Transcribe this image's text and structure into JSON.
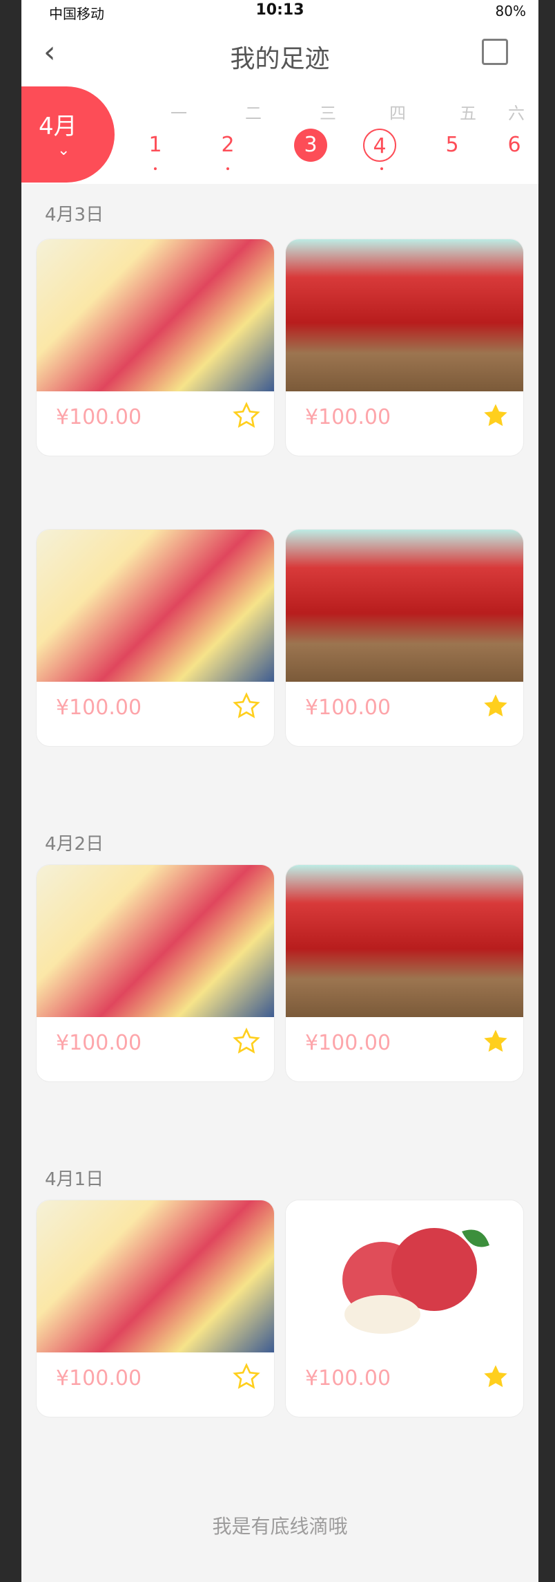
{
  "status": {
    "carrier": "中国移动",
    "time": "10:13",
    "battery": "80%"
  },
  "nav": {
    "back": "‹",
    "title": "我的足迹"
  },
  "calendar": {
    "month": "4月",
    "weekdays": [
      "一",
      "二",
      "三",
      "四",
      "五",
      "六"
    ],
    "days": [
      "1",
      "2",
      "3",
      "4",
      "5",
      "6"
    ]
  },
  "groups": [
    {
      "date": "4月3日",
      "items": [
        {
          "price": "¥100.00",
          "starred": false,
          "img": "fruit"
        },
        {
          "price": "¥100.00",
          "starred": true,
          "img": "apple"
        },
        {
          "price": "¥100.00",
          "starred": false,
          "img": "fruit"
        },
        {
          "price": "¥100.00",
          "starred": true,
          "img": "apple"
        }
      ]
    },
    {
      "date": "4月2日",
      "items": [
        {
          "price": "¥100.00",
          "starred": false,
          "img": "fruit"
        },
        {
          "price": "¥100.00",
          "starred": true,
          "img": "apple"
        }
      ]
    },
    {
      "date": "4月1日",
      "items": [
        {
          "price": "¥100.00",
          "starred": false,
          "img": "fruit"
        },
        {
          "price": "¥100.00",
          "starred": true,
          "img": "apple-white"
        }
      ]
    }
  ],
  "footer": "我是有底线滴哦",
  "colors": {
    "accent": "#fd4d57",
    "star": "#ffcf1d",
    "date": "#828282",
    "footer": "#9d9c9c"
  }
}
